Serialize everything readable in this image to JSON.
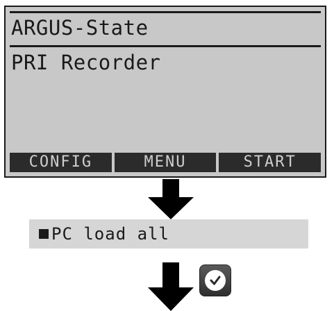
{
  "lcd": {
    "title": "ARGUS-State",
    "subtitle": "PRI Recorder",
    "softkeys": [
      "CONFIG",
      "MENU",
      "START"
    ]
  },
  "menu": {
    "item_label": "PC load all"
  },
  "icons": {
    "down_arrow": "down-arrow-icon",
    "ok_button": "checkmark-icon",
    "bullet": "square-bullet-icon"
  },
  "colors": {
    "lcd_background": "#c8c8c8",
    "softkey_background": "#2b2b2b",
    "softkey_text": "#cfcfcf",
    "menu_background": "#d6d6d6",
    "ink": "#1a1a1a"
  }
}
